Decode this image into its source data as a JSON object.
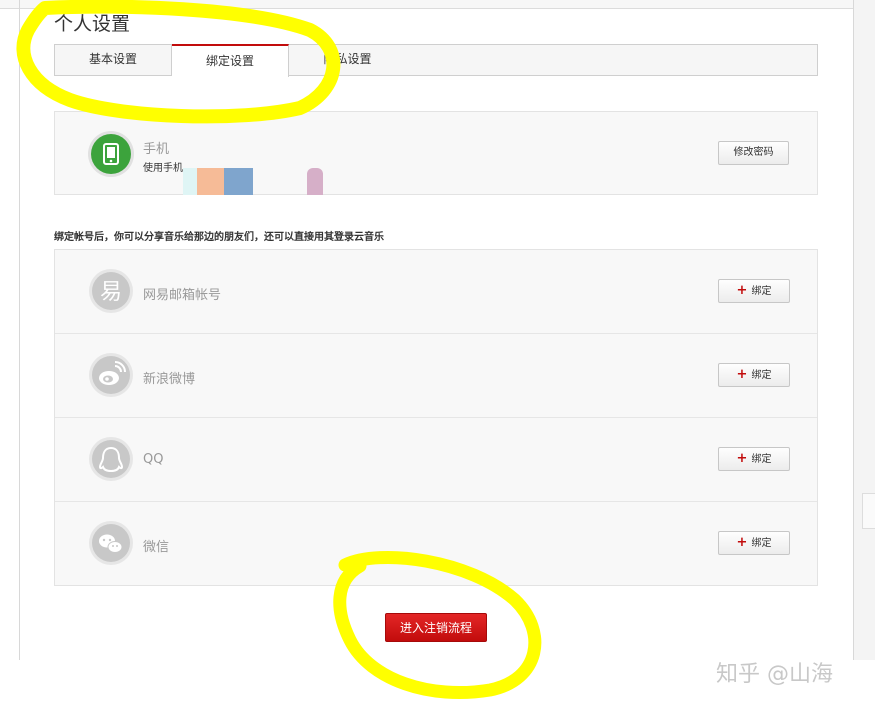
{
  "page": {
    "title": "个人设置"
  },
  "tabs": [
    {
      "label": "基本设置"
    },
    {
      "label": "绑定设置",
      "active": true
    },
    {
      "label": "隐私设置"
    }
  ],
  "phone": {
    "title": "手机",
    "subtitle": "使用手机",
    "icon": "mobile-phone-icon",
    "change_password_label": "修改密码"
  },
  "hint_text": "绑定帐号后，你可以分享音乐给那边的朋友们，还可以直接用其登录云音乐",
  "bindings": [
    {
      "name": "网易邮箱帐号",
      "icon": "netease-mail-icon",
      "button_label": "绑定"
    },
    {
      "name": "新浪微博",
      "icon": "sina-weibo-icon",
      "button_label": "绑定"
    },
    {
      "name": "QQ",
      "icon": "qq-icon",
      "button_label": "绑定"
    },
    {
      "name": "微信",
      "icon": "wechat-icon",
      "button_label": "绑定"
    }
  ],
  "plus_symbol": "+",
  "logout_button_label": "进入注销流程",
  "watermark": "知乎 @山海",
  "colors": {
    "accent_red": "#c20c0c",
    "phone_green": "#3ca33c",
    "highlight_yellow": "#ffff00"
  }
}
